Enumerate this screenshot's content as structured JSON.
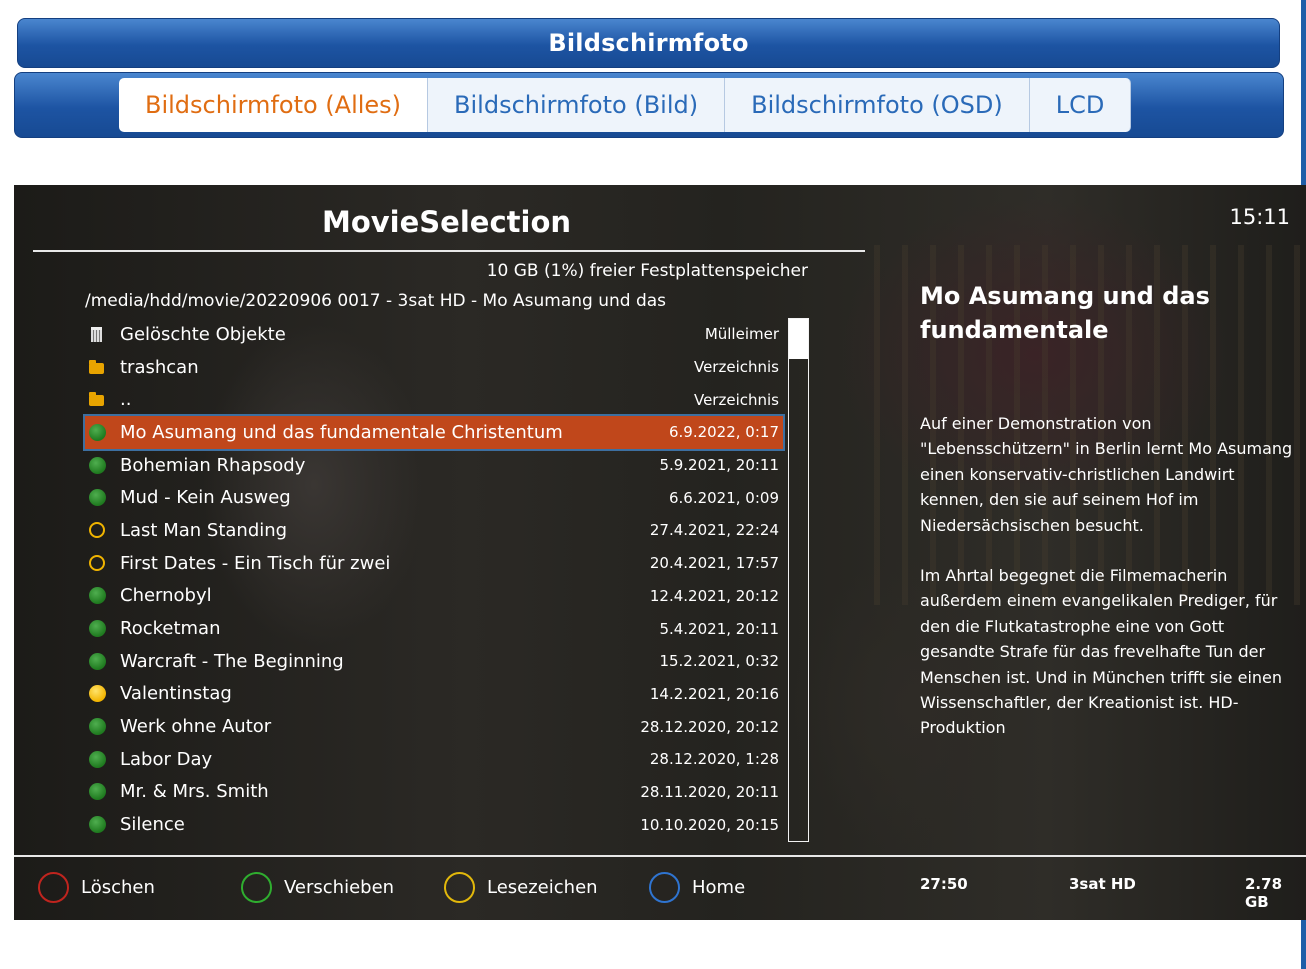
{
  "window": {
    "title": "Bildschirmfoto",
    "tabs": [
      {
        "label": "Bildschirmfoto (Alles)",
        "active": true
      },
      {
        "label": "Bildschirmfoto (Bild)",
        "active": false
      },
      {
        "label": "Bildschirmfoto (OSD)",
        "active": false
      },
      {
        "label": "LCD",
        "active": false
      }
    ]
  },
  "screen": {
    "title": "MovieSelection",
    "clock": "15:11",
    "free_space": "10 GB (1%) freier Festplattenspeicher",
    "path": "/media/hdd/movie/20220906 0017 - 3sat HD - Mo Asumang und das",
    "items": [
      {
        "name": "Gelöschte Objekte",
        "info": "Mülleimer",
        "icon": "trash-icon"
      },
      {
        "name": "trashcan",
        "info": "Verzeichnis",
        "icon": "folder-icon"
      },
      {
        "name": "..",
        "info": "Verzeichnis",
        "icon": "folder-icon"
      },
      {
        "name": "Mo Asumang und das fundamentale Christentum",
        "info": "6.9.2022, 0:17",
        "icon": "green-dot-icon",
        "selected": true
      },
      {
        "name": "Bohemian Rhapsody",
        "info": "5.9.2021, 20:11",
        "icon": "green-dot-icon"
      },
      {
        "name": "Mud - Kein Ausweg",
        "info": "6.6.2021, 0:09",
        "icon": "green-dot-icon"
      },
      {
        "name": "Last Man Standing",
        "info": "27.4.2021, 22:24",
        "icon": "yellow-ring-icon"
      },
      {
        "name": "First Dates - Ein Tisch für zwei",
        "info": "20.4.2021, 17:57",
        "icon": "yellow-ring-icon"
      },
      {
        "name": "Chernobyl",
        "info": "12.4.2021, 20:12",
        "icon": "green-dot-icon"
      },
      {
        "name": "Rocketman",
        "info": "5.4.2021, 20:11",
        "icon": "green-dot-icon"
      },
      {
        "name": "Warcraft - The Beginning",
        "info": "15.2.2021, 0:32",
        "icon": "green-dot-icon"
      },
      {
        "name": "Valentinstag",
        "info": "14.2.2021, 20:16",
        "icon": "yellow-dot-icon"
      },
      {
        "name": "Werk ohne Autor",
        "info": "28.12.2020, 20:12",
        "icon": "green-dot-icon"
      },
      {
        "name": "Labor Day",
        "info": "28.12.2020, 1:28",
        "icon": "green-dot-icon"
      },
      {
        "name": "Mr. & Mrs. Smith",
        "info": "28.11.2020, 20:11",
        "icon": "green-dot-icon"
      },
      {
        "name": "Silence",
        "info": "10.10.2020, 20:15",
        "icon": "green-dot-icon"
      }
    ],
    "description": {
      "title": "Mo Asumang und das fundamentale",
      "paragraph1": "Auf einer Demonstration von \"Lebensschützern\" in Berlin lernt Mo Asumang einen konservativ-christlichen Landwirt kennen, den sie auf seinem Hof im Niedersächsischen besucht.",
      "paragraph2": "Im Ahrtal begegnet die Filmemacherin außerdem einem evangelikalen Prediger, für den die Flutkatastrophe eine von Gott gesandte Strafe für das frevelhafte Tun der Menschen ist. Und in München trifft sie einen Wissenschaftler, der Kreationist ist. HD-Produktion"
    },
    "buttons": {
      "red": "Löschen",
      "green": "Verschieben",
      "yellow": "Lesezeichen",
      "blue": "Home"
    },
    "meta": {
      "duration": "27:50",
      "channel": "3sat HD",
      "size": "2.78 GB"
    },
    "colors": {
      "red": "#c0241e",
      "green": "#2fae2f",
      "yellow": "#e2b80b",
      "blue": "#2f74d0",
      "selection": "#c0471b",
      "accent_tab": "#e06d12"
    }
  }
}
